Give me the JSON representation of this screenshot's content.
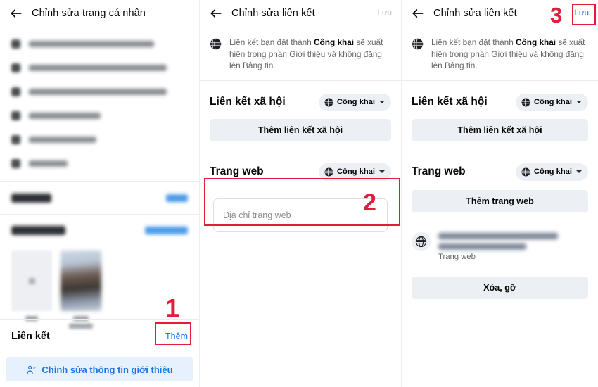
{
  "colors": {
    "accent_blue": "#1877f2",
    "annotation_red": "#e01e3c",
    "grey_button": "#eceff3",
    "cta_background": "#e7f0fd",
    "text_primary": "#050505",
    "text_secondary": "#65676b"
  },
  "panel_profile": {
    "header": {
      "back_icon": "back-arrow-icon",
      "title": "Chỉnh sửa trang cá nhân"
    },
    "blurred_list": [
      {
        "icon": "briefcase-icon",
        "text_width": 178,
        "redacted": true
      },
      {
        "icon": "graduation-cap-icon",
        "text_width": 196,
        "redacted": true
      },
      {
        "icon": "school-icon",
        "text_width": 196,
        "redacted": true
      },
      {
        "icon": "home-icon",
        "text_width": 102,
        "redacted": true
      },
      {
        "icon": "location-icon",
        "text_width": 96,
        "redacted": true
      },
      {
        "icon": "heart-icon",
        "text_width": 55,
        "redacted": true
      }
    ],
    "sections": [
      {
        "title_redacted": true,
        "title_width": 57,
        "link_redacted": true,
        "link_width": 31
      },
      {
        "title_redacted": true,
        "title_width": 77,
        "link_redacted": true,
        "link_width": 61
      }
    ],
    "thumbnails": [
      {
        "kind": "add-placeholder",
        "icon": "plus-icon",
        "caption_widths": [
          18
        ]
      },
      {
        "kind": "photo",
        "caption_widths": [
          22,
          34
        ]
      }
    ],
    "links_section": {
      "title": "Liên kết",
      "action_label": "Thêm"
    },
    "cta": {
      "icon": "person-edit-icon",
      "label": "Chỉnh sửa thông tin giới thiệu"
    }
  },
  "panel_edit_empty": {
    "header": {
      "back_icon": "back-arrow-icon",
      "title": "Chỉnh sửa liên kết",
      "save_label": "Lưu",
      "save_enabled": false
    },
    "info": {
      "icon": "globe-icon",
      "text_before": "Liên kết bạn đặt thành ",
      "text_bold": "Công khai",
      "text_after": " sẽ xuất hiện trong phần Giới thiệu và không đăng lên Bảng tin."
    },
    "social_group": {
      "title": "Liên kết xã hội",
      "privacy": {
        "icon": "globe-icon",
        "label": "Công khai",
        "caret": "chevron-down-icon"
      },
      "add_button": "Thêm liên kết xã hội"
    },
    "website_group": {
      "title": "Trang web",
      "privacy": {
        "icon": "globe-icon",
        "label": "Công khai",
        "caret": "chevron-down-icon"
      },
      "input_placeholder": "Địa chỉ trang web",
      "input_value": ""
    }
  },
  "panel_edit_saved": {
    "header": {
      "back_icon": "back-arrow-icon",
      "title": "Chỉnh sửa liên kết",
      "save_label": "Lưu",
      "save_enabled": true
    },
    "info": {
      "icon": "globe-icon",
      "text_before": "Liên kết bạn đặt thành ",
      "text_bold": "Công khai",
      "text_after": " sẽ xuất hiện trong phần Giới thiệu và không đăng lên Bảng tin."
    },
    "social_group": {
      "title": "Liên kết xã hội",
      "privacy": {
        "icon": "globe-icon",
        "label": "Công khai",
        "caret": "chevron-down-icon"
      },
      "add_button": "Thêm liên kết xã hội"
    },
    "website_group": {
      "title": "Trang web",
      "privacy": {
        "icon": "globe-icon",
        "label": "Công khai",
        "caret": "chevron-down-icon"
      },
      "add_button": "Thêm trang web"
    },
    "entry": {
      "icon": "globe-outline-icon",
      "url_redacted": true,
      "url_line_widths": [
        170,
        125
      ],
      "sub_label": "Trang web",
      "remove_button": "Xóa, gỡ"
    }
  },
  "annotations": [
    {
      "number": "1",
      "target": "add-link-action"
    },
    {
      "number": "2",
      "target": "website-url-input"
    },
    {
      "number": "3",
      "target": "save-button"
    }
  ]
}
